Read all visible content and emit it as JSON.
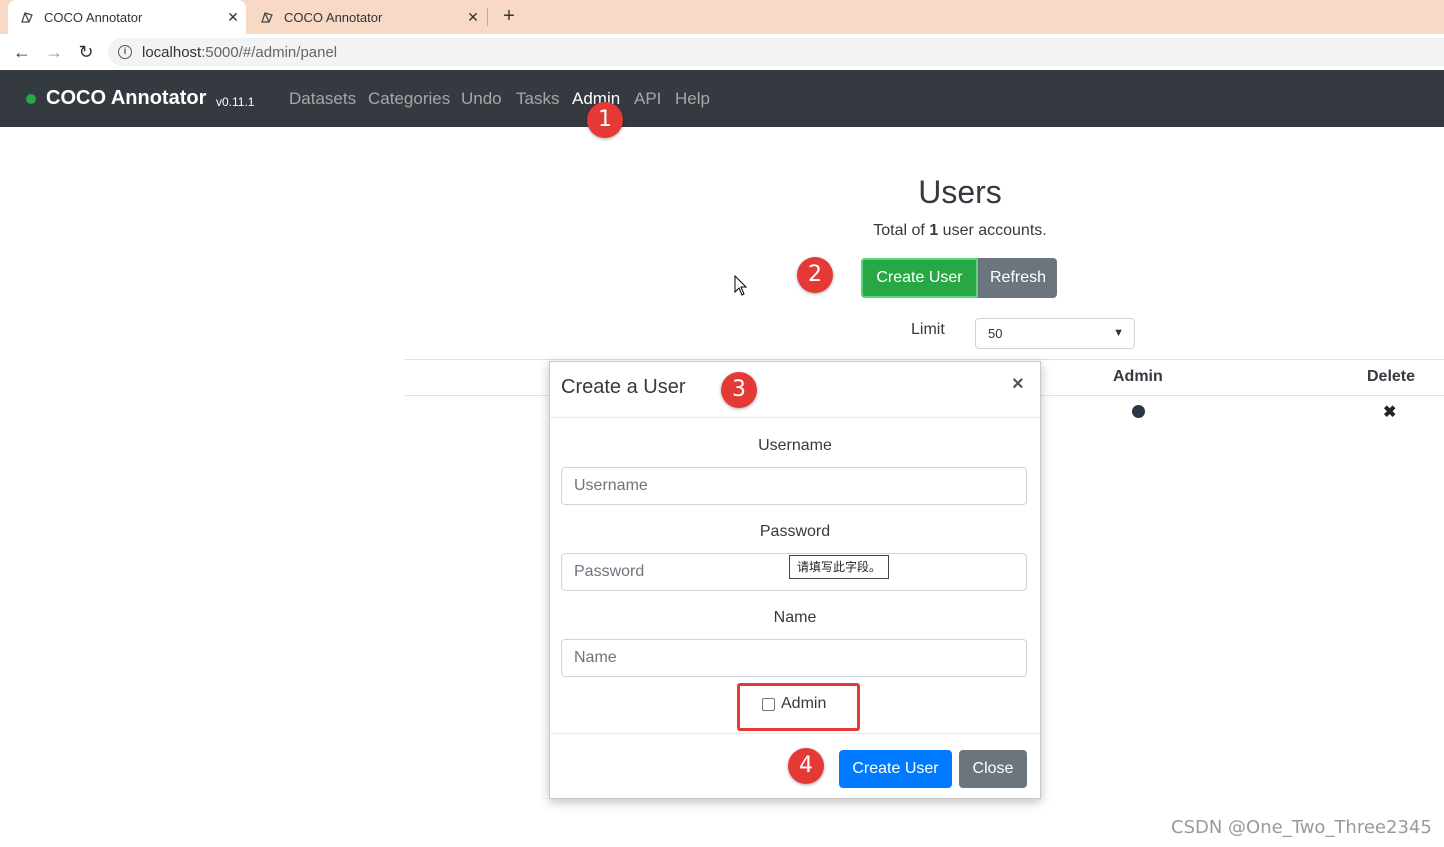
{
  "browser": {
    "tabs": [
      {
        "title": "COCO Annotator",
        "active": true
      },
      {
        "title": "COCO Annotator",
        "active": false
      }
    ],
    "new_tab_icon": "plus-icon",
    "url_host": "localhost",
    "url_rest": ":5000/#/admin/panel"
  },
  "navbar": {
    "brand": "COCO Annotator",
    "version": "v0.11.1",
    "status_color": "#28a745",
    "links": [
      "Datasets",
      "Categories",
      "Undo",
      "Tasks",
      "Admin",
      "API",
      "Help"
    ],
    "active_link": "Admin"
  },
  "annotations": [
    "1",
    "2",
    "3",
    "4"
  ],
  "users_page": {
    "title": "Users",
    "total_prefix": "Total of ",
    "total_count": "1",
    "total_suffix": " user accounts.",
    "create_button": "Create User",
    "refresh_button": "Refresh",
    "limit_label": "Limit",
    "limit_value": "50",
    "columns": [
      "Admin",
      "Delete"
    ]
  },
  "modal": {
    "title": "Create a User",
    "close_icon": "×",
    "username_label": "Username",
    "username_placeholder": "Username",
    "password_label": "Password",
    "password_placeholder": "Password",
    "tooltip": "请填写此字段。",
    "name_label": "Name",
    "name_placeholder": "Name",
    "admin_checkbox_label": "Admin",
    "create_button": "Create User",
    "close_button": "Close"
  },
  "colors": {
    "accent_highlight": "#e53935",
    "primary": "#007bff",
    "success": "#28a745",
    "secondary": "#6c757d",
    "navbar_bg": "#343a40"
  },
  "watermark": "CSDN @One_Two_Three2345"
}
